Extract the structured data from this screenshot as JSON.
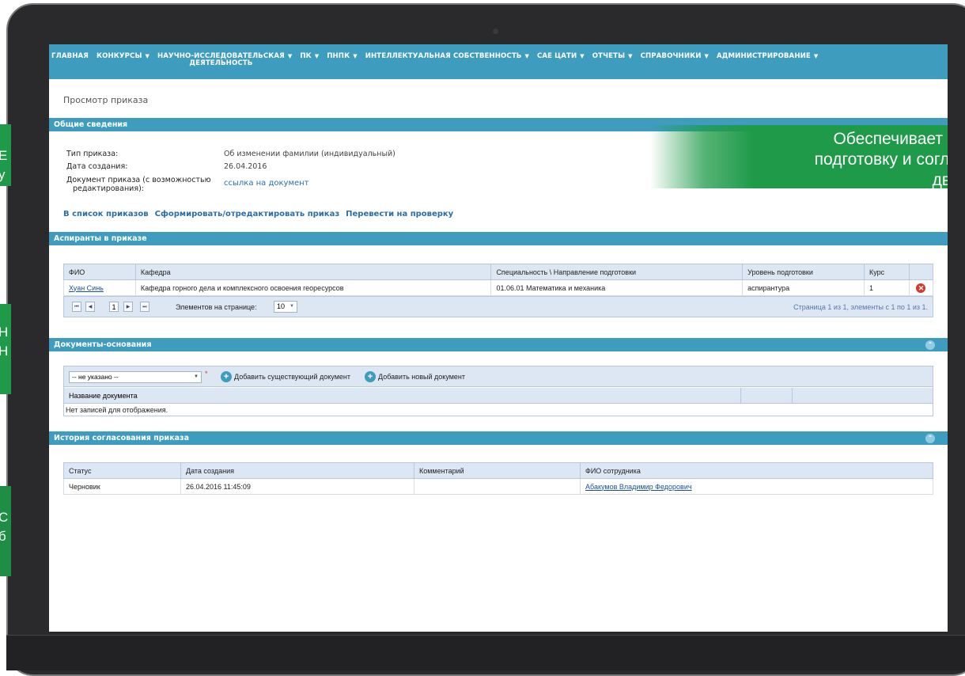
{
  "nav": {
    "items": [
      {
        "label": "ГЛАВНАЯ",
        "dropdown": false
      },
      {
        "label": "КОНКУРСЫ",
        "dropdown": true
      },
      {
        "label": "НАУЧНО-ИССЛЕДОВАТЕЛЬСКАЯ",
        "label2": "ДЕЯТЕЛЬНОСТЬ",
        "dropdown": true
      },
      {
        "label": "ПК",
        "dropdown": true
      },
      {
        "label": "ПНПК",
        "dropdown": true
      },
      {
        "label": "ИНТЕЛЛЕКТУАЛЬНАЯ СОБСТВЕННОСТЬ",
        "dropdown": true
      },
      {
        "label": "САЕ ЦАТИ",
        "dropdown": true
      },
      {
        "label": "ОТЧЕТЫ",
        "dropdown": true
      },
      {
        "label": "СПРАВОЧНИКИ",
        "dropdown": true
      },
      {
        "label": "АДМИНИСТРИРОВАНИЕ",
        "dropdown": true
      }
    ],
    "caret": "▼"
  },
  "page_title": "Просмотр приказа",
  "general": {
    "header": "Общие сведения",
    "order_type_label": "Тип приказа:",
    "order_type_value": "Об изменении фамилии (индивидуальный)",
    "created_label": "Дата создания:",
    "created_value": "26.04.2016",
    "doc_label_1": "Документ приказа (с возможностью",
    "doc_label_2": "редактирования):",
    "doc_link": "ссылка на документ"
  },
  "actions": {
    "to_list": "В список приказов",
    "form_edit": "Сформировать/отредактировать приказ",
    "send_review": "Перевести на проверку"
  },
  "students": {
    "header": "Аспиранты в приказе",
    "columns": [
      "ФИО",
      "Кафедра",
      "Специальность \\ Направление подготовки",
      "Уровень подготовки",
      "Курс"
    ],
    "rows": [
      {
        "fio": "Хуан Синь",
        "dept": "Кафедра горного дела и комплексного освоения георесурсов",
        "spec": "01.06.01 Математика и механика",
        "level": "аспирантура",
        "course": "1"
      }
    ],
    "pager": {
      "page": "1",
      "items_label": "Элементов на странице:",
      "page_size": "10",
      "info": "Страница 1 из 1, элементы с 1 по 1 из 1."
    }
  },
  "documents": {
    "header": "Документы-основания",
    "select_value": "-- не указано --",
    "required_mark": "*",
    "add_existing": "Добавить существующий документ",
    "add_new": "Добавить новый документ",
    "column_name": "Название документа",
    "empty": "Нет записей для отображения."
  },
  "history": {
    "header": "История согласования приказа",
    "columns": [
      "Статус",
      "Дата создания",
      "Комментарий",
      "ФИО сотрудника"
    ],
    "rows": [
      {
        "status": "Черновик",
        "date": "26.04.2016 11:45:09",
        "comment": "",
        "employee": "Абакумов Владимир Федорович"
      }
    ]
  },
  "promo": {
    "line1": "Обеспечивает",
    "line2": "подготовку и согла",
    "line3": "дв"
  },
  "side_tabs": [
    "Е",
    "у",
    "Н",
    "Н",
    "С",
    "б"
  ],
  "colors": {
    "nav_bar": "#3e9dbf",
    "link": "#2a6ea8",
    "promo_green": "#1e9a48",
    "delete_red": "#d23a2c"
  }
}
